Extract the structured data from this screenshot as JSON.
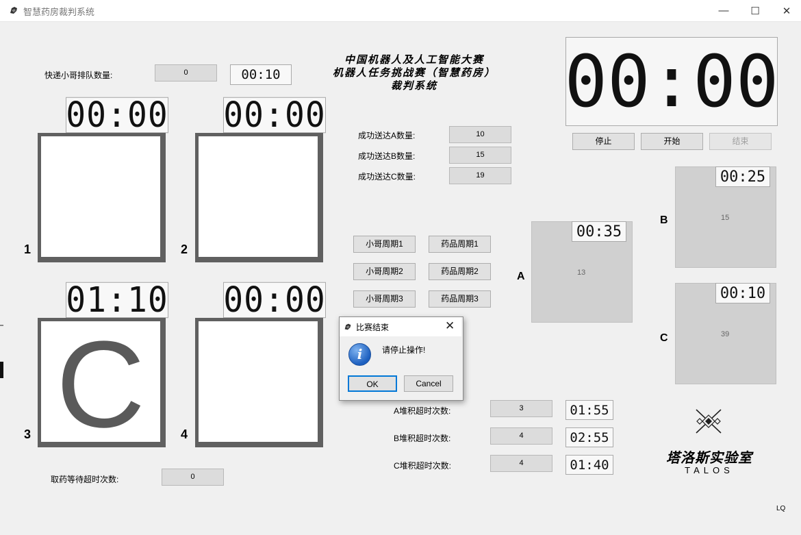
{
  "window": {
    "title": "智慧药房裁判系统",
    "min_glyph": "—",
    "max_glyph": "☐",
    "close_glyph": "✕"
  },
  "contest_title": [
    "中国机器人及人工智能大赛",
    "机器人任务挑战赛（智慧药房）",
    "裁判系统"
  ],
  "main_timer": "00:00",
  "queue": {
    "label": "快递小哥排队数量:",
    "value": "0",
    "timer": "00:10"
  },
  "delivered": [
    {
      "label": "成功送达A数量:",
      "value": "10"
    },
    {
      "label": "成功送达B数量:",
      "value": "15"
    },
    {
      "label": "成功送达C数量:",
      "value": "19"
    }
  ],
  "controls": {
    "stop": "停止",
    "start": "开始",
    "end": "结束"
  },
  "bins": [
    {
      "num": "1",
      "timer": "00:00",
      "letter": ""
    },
    {
      "num": "2",
      "timer": "00:00",
      "letter": ""
    },
    {
      "num": "3",
      "timer": "01:10",
      "letter": "C"
    },
    {
      "num": "4",
      "timer": "00:00",
      "letter": ""
    }
  ],
  "cycle_buttons": [
    "小哥周期1",
    "药品周期1",
    "小哥周期2",
    "药品周期2",
    "小哥周期3",
    "药品周期3"
  ],
  "zones": [
    {
      "label": "A",
      "timer": "00:35",
      "value": "13"
    },
    {
      "label": "B",
      "timer": "00:25",
      "value": "15"
    },
    {
      "label": "C",
      "timer": "00:10",
      "value": "39"
    }
  ],
  "stack_timeouts": [
    {
      "label": "A堆积超时次数:",
      "value": "3",
      "timer": "01:55"
    },
    {
      "label": "B堆积超时次数:",
      "value": "4",
      "timer": "02:55"
    },
    {
      "label": "C堆积超时次数:",
      "value": "4",
      "timer": "01:40"
    }
  ],
  "pickup_wait": {
    "label": "取药等待超时次数:",
    "value": "0"
  },
  "dialog": {
    "title": "比赛结束",
    "message": "请停止操作!",
    "ok": "OK",
    "cancel": "Cancel",
    "icon": "info-icon",
    "close_glyph": "✕"
  },
  "lab": {
    "name": "塔洛斯实验室",
    "english": "TALOS"
  },
  "footer_tag": "LQ"
}
